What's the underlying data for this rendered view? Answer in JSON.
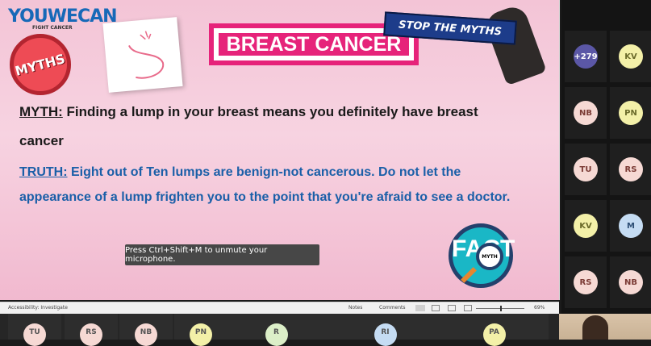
{
  "slide": {
    "logo": "YOUWECAN",
    "logo_sub": "FIGHT CANCER",
    "badge": "MYTHS",
    "title": "BREAST CANCER",
    "stop_text": "STOP THE MYTHS",
    "myth_label": "MYTH:",
    "myth_text_1": " Finding a lump in your breast means you definitely have breast",
    "myth_text_2": "cancer",
    "truth_label": "TRUTH:",
    "truth_text_1": " Eight out of Ten lumps are benign-not cancerous. Do not let the",
    "truth_text_2": "appearance of a lump frighten you to the point that you're afraid to see a doctor.",
    "fact": "FACT",
    "lens_text": "MYTH"
  },
  "toast": "Press Ctrl+Shift+M to unmute your microphone.",
  "statusbar": {
    "left": "Accessibility: Investigate",
    "notes": "Notes",
    "comments": "Comments",
    "zoom": "69%"
  },
  "participants": [
    {
      "initials": "+279",
      "bg": "#5b57a6",
      "fg": "#ffffff"
    },
    {
      "initials": "KV",
      "bg": "#f3f0a8",
      "fg": "#6a6a2a"
    },
    {
      "initials": "NB",
      "bg": "#f6d9d4",
      "fg": "#7a3a34"
    },
    {
      "initials": "PN",
      "bg": "#f3f0a8",
      "fg": "#6a6a2a"
    },
    {
      "initials": "TU",
      "bg": "#f6d9d4",
      "fg": "#7a3a34"
    },
    {
      "initials": "RS",
      "bg": "#f6d9d4",
      "fg": "#7a3a34"
    },
    {
      "initials": "KV",
      "bg": "#f3f0a8",
      "fg": "#6a6a2a"
    },
    {
      "initials": "M",
      "bg": "#c5dcf3",
      "fg": "#2c4d74"
    },
    {
      "initials": "RS",
      "bg": "#f6d9d4",
      "fg": "#7a3a34"
    },
    {
      "initials": "NB",
      "bg": "#f6d9d4",
      "fg": "#7a3a34"
    }
  ],
  "bottom_participants": [
    {
      "initials": "TU",
      "bg": "#f6d9d4"
    },
    {
      "initials": "RS",
      "bg": "#f6d9d4"
    },
    {
      "initials": "NB",
      "bg": "#f6d9d4"
    },
    {
      "initials": "PN",
      "bg": "#f3f0a8"
    },
    {
      "initials": "R",
      "bg": "#dcefc8"
    },
    {
      "initials": "RI",
      "bg": "#c5dcf3"
    },
    {
      "initials": "PA",
      "bg": "#f3f0a8"
    }
  ],
  "colors": {
    "accent_pink": "#e6237a",
    "truth_blue": "#1a5fa8",
    "logo_blue": "#1769b8"
  }
}
